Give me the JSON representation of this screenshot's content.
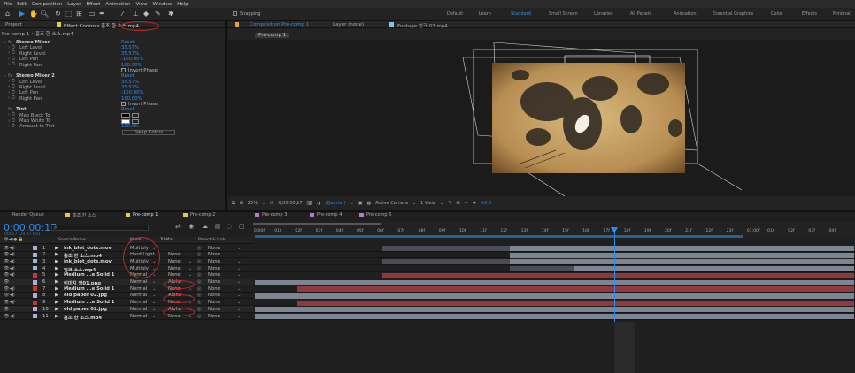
{
  "menu": [
    "File",
    "Edit",
    "Composition",
    "Layer",
    "Effect",
    "Animation",
    "View",
    "Window",
    "Help"
  ],
  "toolbar": {
    "snapping": "Snapping",
    "workspaces": [
      "Default",
      "Learn",
      "Standard",
      "Small Screen",
      "Libraries",
      "All Panels",
      "Animation",
      "Essential Graphics",
      "Color",
      "Effects",
      "Minimal"
    ],
    "active_workspace": "Standard"
  },
  "effect_panel": {
    "tab_project": "Project",
    "tab_effects": "Effect Controls 홈조 한 소스.mp4",
    "subtitle": "Pre-comp 1 • 홈조 한 소스.mp4",
    "rows": [
      {
        "t": "fx",
        "name": "Stereo Mixer",
        "val": "Reset"
      },
      {
        "t": "p",
        "name": "Left Level",
        "val": "35.57%"
      },
      {
        "t": "p",
        "name": "Right Level",
        "val": "35.57%"
      },
      {
        "t": "p",
        "name": "Left Pan",
        "val": "-100.00%"
      },
      {
        "t": "p",
        "name": "Right Pan",
        "val": "100.00%"
      },
      {
        "t": "c",
        "name": "",
        "val": "Invert Phase"
      },
      {
        "t": "fx",
        "name": "Stereo Mixer 2",
        "val": "Reset"
      },
      {
        "t": "p",
        "name": "Left Level",
        "val": "35.57%"
      },
      {
        "t": "p",
        "name": "Right Level",
        "val": "35.57%"
      },
      {
        "t": "p",
        "name": "Left Pan",
        "val": "-100.00%"
      },
      {
        "t": "p",
        "name": "Right Pan",
        "val": "100.00%"
      },
      {
        "t": "c",
        "name": "",
        "val": "Invert Phase"
      },
      {
        "t": "fx",
        "name": "Tint",
        "val": "Reset"
      },
      {
        "t": "sw",
        "name": "Map Black To",
        "val": ""
      },
      {
        "t": "sw",
        "name": "Map White To",
        "val": ""
      },
      {
        "t": "p",
        "name": "Amount to Tint",
        "val": "100.0%"
      },
      {
        "t": "b",
        "name": "",
        "val": "Swap Colors"
      }
    ]
  },
  "comp_panel": {
    "tab_comp": "Composition Pre-comp 1",
    "tab_layer": "Layer (none)",
    "tab_footage": "Footage 엉크 03.mp4",
    "breadcrumb": "Pre-comp 1"
  },
  "viewer_bar": {
    "zoom": "25%",
    "timecode": "0;00;00;17",
    "res": "(Quarter)",
    "camera": "Active Camera",
    "view": "1 View",
    "offset": "+0.0"
  },
  "timeline": {
    "tabs": [
      "Render Queue",
      "홈조 한 소스",
      "Pre-comp 1",
      "Pre-comp 2",
      "Pre-comp 3",
      "Pre-comp 4",
      "Pre-comp 5"
    ],
    "timecode": "0:00:00:17",
    "fps": "00017 (29.97 fps)",
    "cols": {
      "source": "Source Name",
      "mode": "Mode",
      "trk": "TrkMat",
      "parent": "Parent & Link"
    },
    "ruler": [
      "0:00f",
      "01f",
      "02f",
      "03f",
      "04f",
      "05f",
      "06f",
      "07f",
      "08f",
      "09f",
      "10f",
      "11f",
      "12f",
      "13f",
      "14f",
      "15f",
      "16f",
      "17f",
      "18f",
      "19f",
      "20f",
      "21f",
      "22f",
      "23f",
      "01:00f",
      "01f",
      "02f",
      "03f",
      "04f"
    ],
    "layers": [
      {
        "n": "1",
        "name": "ink_blot_dots.mov",
        "mode": "Multiply",
        "trk": "",
        "parent": "None",
        "color": "#a9b0d6"
      },
      {
        "n": "2",
        "name": "홈조 한 소스.mp4",
        "mode": "Hard Light",
        "trk": "None",
        "parent": "None",
        "color": "#a9b0d6"
      },
      {
        "n": "3",
        "name": "ink_blot_dots.mov",
        "mode": "Multiply",
        "trk": "None",
        "parent": "None",
        "color": "#a9b0d6"
      },
      {
        "n": "4",
        "name": "엉크 소스.mp4",
        "mode": "Multiply",
        "trk": "None",
        "parent": "None",
        "color": "#a9b0d6"
      },
      {
        "n": "5",
        "name": "Medium ...e Solid 1",
        "mode": "Normal",
        "trk": "None",
        "parent": "None",
        "color": "#c9352f"
      },
      {
        "n": "6",
        "name": "이미지 엉01.png",
        "mode": "Normal",
        "trk": "Alpha",
        "parent": "None",
        "color": "#a9b0d6"
      },
      {
        "n": "7",
        "name": "Medium ...e Solid 1",
        "mode": "Normal",
        "trk": "None",
        "parent": "None",
        "color": "#c9352f"
      },
      {
        "n": "8",
        "name": "old paper 02.jpg",
        "mode": "Normal",
        "trk": "Alpha",
        "parent": "None",
        "color": "#a9b0d6"
      },
      {
        "n": "9",
        "name": "Medium ...e Solid 1",
        "mode": "Normal",
        "trk": "None",
        "parent": "None",
        "color": "#c9352f"
      },
      {
        "n": "10",
        "name": "old paper 02.jpg",
        "mode": "Normal",
        "trk": "Alpha",
        "parent": "None",
        "color": "#a9b0d6"
      },
      {
        "n": "11",
        "name": "홈조 한 소스.mp4",
        "mode": "Normal",
        "trk": "None",
        "parent": "None",
        "color": "#a9b0d6"
      }
    ]
  }
}
